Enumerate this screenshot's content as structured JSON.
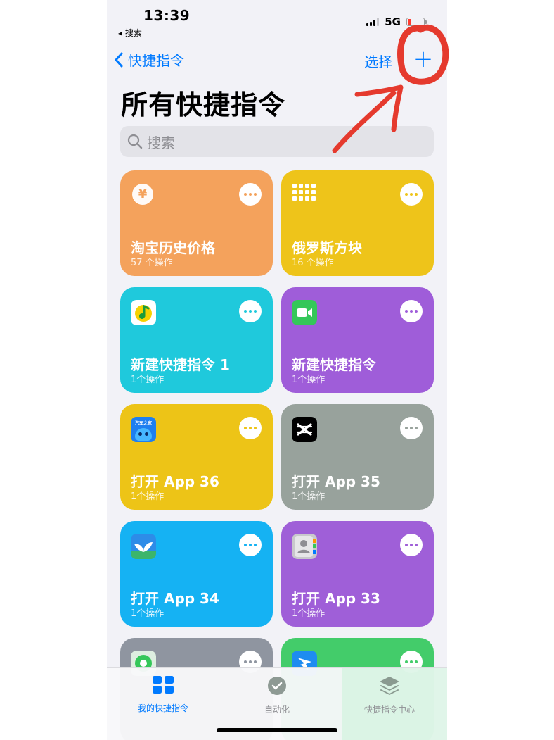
{
  "status": {
    "time": "13:39",
    "back_app": "◂ 搜索",
    "network": "5G"
  },
  "nav": {
    "back_label": "快捷指令",
    "select_label": "选择",
    "add_symbol": "+"
  },
  "page": {
    "title": "所有快捷指令"
  },
  "search": {
    "placeholder": "搜索"
  },
  "colors": {
    "accent": "#007aff",
    "annotation": "#e53a2e"
  },
  "shortcuts": [
    {
      "title": "淘宝历史价格",
      "subtitle": "57 个操作",
      "color": "#f4a25c",
      "icon": "yen-icon"
    },
    {
      "title": "俄罗斯方块",
      "subtitle": "16 个操作",
      "color": "#eec41a",
      "icon": "grid-dots-icon"
    },
    {
      "title": "新建快捷指令 1",
      "subtitle": "1个操作",
      "color": "#1fc9dc",
      "icon": "qq-music-app-icon"
    },
    {
      "title": "新建快捷指令",
      "subtitle": "1个操作",
      "color": "#9f5dd9",
      "icon": "facetime-app-icon"
    },
    {
      "title": "打开 App 36",
      "subtitle": "1个操作",
      "color": "#edc417",
      "icon": "autohome-app-icon",
      "icon_text": "汽车之家"
    },
    {
      "title": "打开 App 35",
      "subtitle": "1个操作",
      "color": "#98a29c",
      "icon": "capcut-app-icon"
    },
    {
      "title": "打开 App 34",
      "subtitle": "1个操作",
      "color": "#15b2f3",
      "icon": "sprout-app-icon"
    },
    {
      "title": "打开 App 33",
      "subtitle": "1个操作",
      "color": "#9f5fd8",
      "icon": "contacts-app-icon"
    },
    {
      "title": "",
      "subtitle": "",
      "color": "#8f95a0",
      "icon": "find-my-app-icon"
    },
    {
      "title": "",
      "subtitle": "",
      "color": "#43cc6a",
      "icon": "dingtalk-app-icon"
    }
  ],
  "tabs": [
    {
      "label": "我的快捷指令",
      "icon": "my-shortcuts-icon",
      "active": true
    },
    {
      "label": "自动化",
      "icon": "automation-clock-icon",
      "active": false
    },
    {
      "label": "快捷指令中心",
      "icon": "gallery-layers-icon",
      "active": false
    }
  ]
}
